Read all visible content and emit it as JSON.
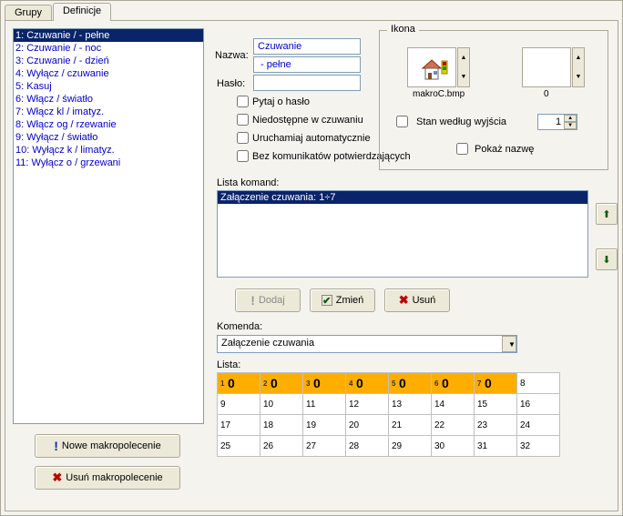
{
  "tabs": {
    "grupy": "Grupy",
    "definicje": "Definicje"
  },
  "macro_list": [
    "1: Czuwanie /  - pełne",
    "2: Czuwanie /  - noc",
    "3: Czuwanie /  - dzień",
    "4: Wyłącz / czuwanie",
    "5: Kasuj",
    "6: Włącz / światło",
    "7: Włącz kl / imatyz.",
    "8: Włącz og / rzewanie",
    "9: Wyłącz / światło",
    "10: Wyłącz k / limatyz.",
    "11: Wyłącz o / grzewani"
  ],
  "buttons": {
    "new_macro": "Nowe makropolecenie",
    "del_macro": "Usuń makropolecenie",
    "dodaj": "Dodaj",
    "zmien": "Zmień",
    "usun": "Usuń"
  },
  "form": {
    "name_label": "Nazwa:",
    "name_value1": "Czuwanie",
    "name_value2": " - pełne",
    "pass_label": "Hasło:",
    "pass_value": "",
    "chk_ask_pass": "Pytaj o hasło",
    "chk_unavail": "Niedostępne w czuwaniu",
    "chk_auto": "Uruchamiaj automatycznie",
    "chk_nomsg": "Bez komunikatów potwierdzających"
  },
  "ikona": {
    "legend": "Ikona",
    "left_caption": "makroC.bmp",
    "right_caption": "0",
    "stan_label": "Stan według wyjścia",
    "stan_value": "1",
    "pokaz": "Pokaż nazwę"
  },
  "lista_komand_label": "Lista komand:",
  "lista_komand_item": "Załączenie czuwania: 1÷7",
  "komenda_label": "Komenda:",
  "komenda_value": "Załączenie czuwania",
  "lista2_label": "Lista:",
  "grid_headers": [
    {
      "idx": "1",
      "val": "0"
    },
    {
      "idx": "2",
      "val": "0"
    },
    {
      "idx": "3",
      "val": "0"
    },
    {
      "idx": "4",
      "val": "0"
    },
    {
      "idx": "5",
      "val": "0"
    },
    {
      "idx": "6",
      "val": "0"
    },
    {
      "idx": "7",
      "val": "0"
    }
  ],
  "grid_rows": [
    [
      "8",
      "9",
      "10",
      "11",
      "12",
      "13",
      "14",
      "15",
      "16"
    ],
    [
      "",
      "17",
      "18",
      "19",
      "20",
      "21",
      "22",
      "23",
      "24"
    ],
    [
      "",
      "25",
      "26",
      "27",
      "28",
      "29",
      "30",
      "31",
      "32"
    ]
  ]
}
